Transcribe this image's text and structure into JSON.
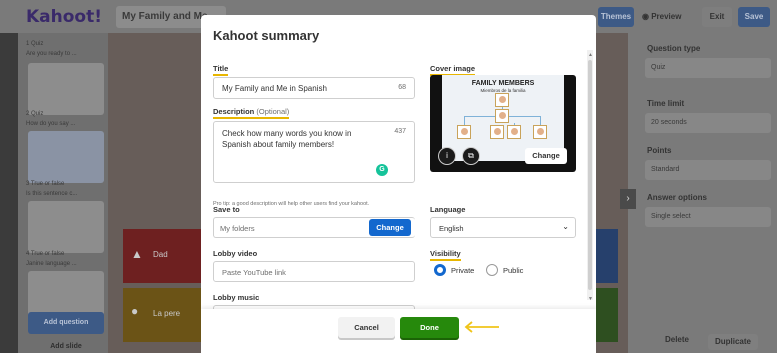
{
  "background": {
    "logo": "Kahoot!",
    "kahoot_title": "My Family and Me",
    "themes_label": "Themes",
    "preview_label": "Preview",
    "exit_label": "Exit",
    "save_label": "Save",
    "slides": [
      {
        "header": "1  Quiz",
        "text": "Are you ready to ..."
      },
      {
        "header": "2  Quiz",
        "text": "How do you say ..."
      },
      {
        "header": "3  True or false",
        "text": "Is this sentence c..."
      },
      {
        "header": "4  True or false",
        "text": "Janine language ..."
      }
    ],
    "add_question_label": "Add question",
    "add_slide_label": "Add slide",
    "answers": [
      {
        "label": "Dad"
      },
      {
        "label": "La pere"
      }
    ],
    "right_panel": {
      "question_type_label": "Question type",
      "question_type_value": "Quiz",
      "time_limit_label": "Time limit",
      "time_limit_value": "20 seconds",
      "points_label": "Points",
      "points_value": "Standard",
      "answer_options_label": "Answer options",
      "answer_options_value": "Single select",
      "delete_label": "Delete",
      "duplicate_label": "Duplicate"
    }
  },
  "modal": {
    "title": "Kahoot summary",
    "title_field": {
      "label": "Title",
      "value": "My Family and Me in Spanish",
      "counter": "68"
    },
    "description_field": {
      "label": "Description",
      "optional": "(Optional)",
      "value": "Check how many words you know in Spanish about family members!",
      "counter": "437"
    },
    "tip": "Pro tip: a good description will help other users find your kahoot.",
    "cover_image": {
      "label": "Cover image",
      "heading": "FAMILY MEMBERS",
      "subheading": "Miembros de la familia",
      "change_label": "Change"
    },
    "save_to": {
      "label": "Save to",
      "value": "My folders",
      "change_label": "Change"
    },
    "language": {
      "label": "Language",
      "value": "English"
    },
    "lobby_video": {
      "label": "Lobby video",
      "placeholder": "Paste YouTube link"
    },
    "visibility": {
      "label": "Visibility",
      "options": [
        "Private",
        "Public"
      ],
      "selected": "Private"
    },
    "lobby_music": {
      "label": "Lobby music"
    },
    "cancel_label": "Cancel",
    "done_label": "Done"
  },
  "colors": {
    "accent_blue": "#1368ce",
    "done_green": "#26890c",
    "underline_yellow": "#e8b600",
    "grammarly_green": "#15c39a"
  },
  "icons": [
    "info-icon",
    "image-search-icon",
    "chevron-down-icon",
    "grammarly-icon",
    "arrow-left-icon"
  ]
}
